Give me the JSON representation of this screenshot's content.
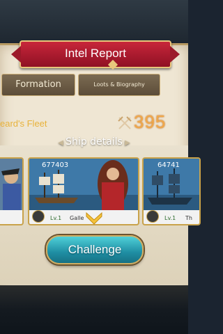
{
  "header": {
    "title": "Intel Report"
  },
  "tabs": [
    {
      "label": "Formation"
    },
    {
      "label": "Loots & Biography"
    }
  ],
  "fleet": {
    "name": "eard's Fleet",
    "power": "395"
  },
  "ship_details": {
    "label": "Ship details"
  },
  "cards": [
    {
      "power": "",
      "level": "",
      "name": ""
    },
    {
      "power": "677403",
      "level": "Lv.1",
      "name": "Galle"
    },
    {
      "power": "64741",
      "level": "Lv.1",
      "name": "Th"
    }
  ],
  "actions": {
    "challenge_label": "Challenge"
  },
  "colors": {
    "accent_red": "#c8263a",
    "gold": "#e8b23a",
    "teal_button": "#1f8ea3"
  },
  "icons": [
    "crossed-swords-icon",
    "chevron-down-icon",
    "ship-type-icon"
  ]
}
